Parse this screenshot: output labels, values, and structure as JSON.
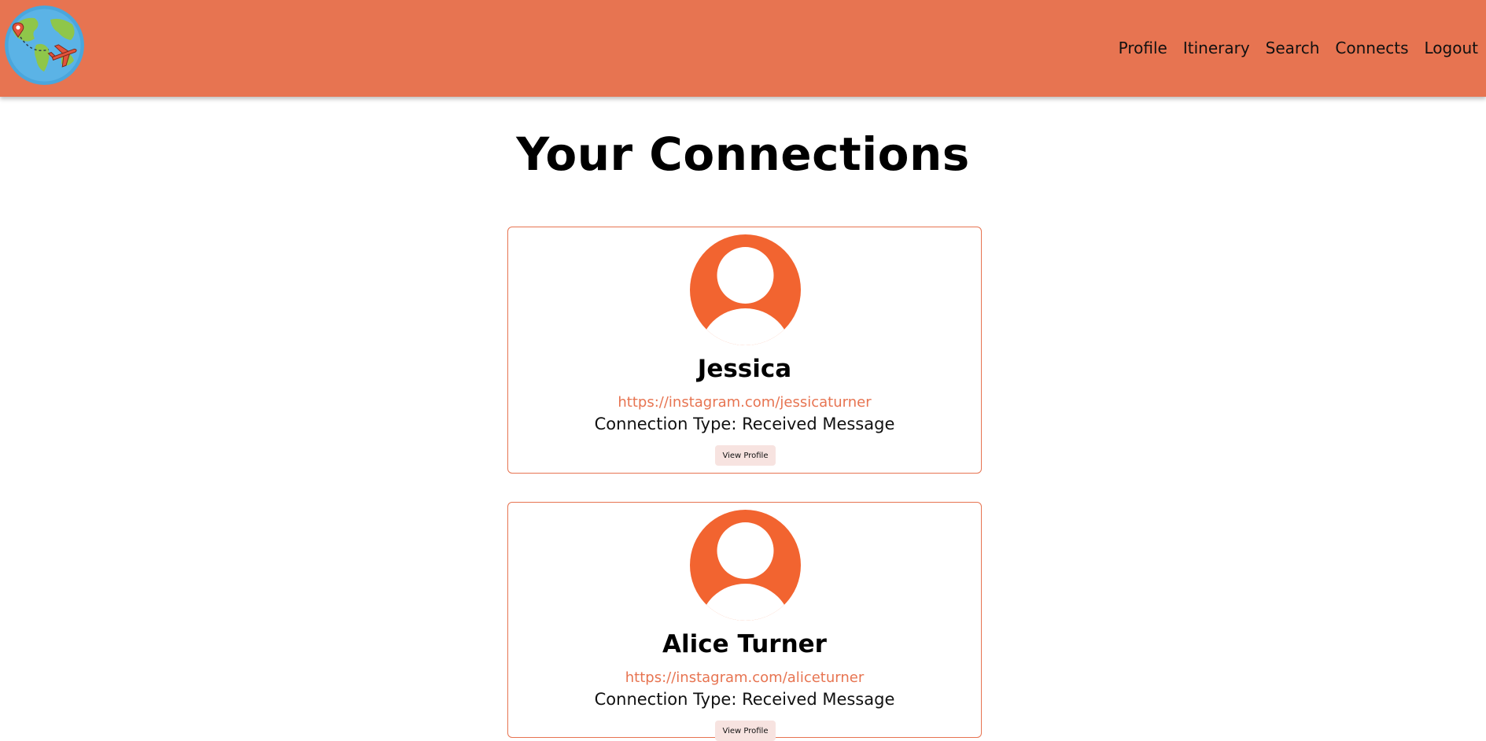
{
  "header": {
    "logo_icon": "globe-airplane-logo-icon",
    "nav": [
      {
        "label": "Profile"
      },
      {
        "label": "Itinerary"
      },
      {
        "label": "Search"
      },
      {
        "label": "Connects"
      },
      {
        "label": "Logout"
      }
    ]
  },
  "main": {
    "title": "Your Connections",
    "connections": [
      {
        "name": "Jessica",
        "link": "https://instagram.com/jessicaturner",
        "connection_type": "Connection Type: Received Message",
        "button_label": "View Profile",
        "avatar_icon": "user-avatar-icon"
      },
      {
        "name": "Alice Turner",
        "link": "https://instagram.com/aliceturner",
        "connection_type": "Connection Type: Received Message",
        "button_label": "View Profile",
        "avatar_icon": "user-avatar-icon"
      }
    ]
  },
  "colors": {
    "header_bg": "#e77451",
    "accent": "#f26430",
    "link": "#e77451",
    "button_bg": "#f7e3e0"
  }
}
